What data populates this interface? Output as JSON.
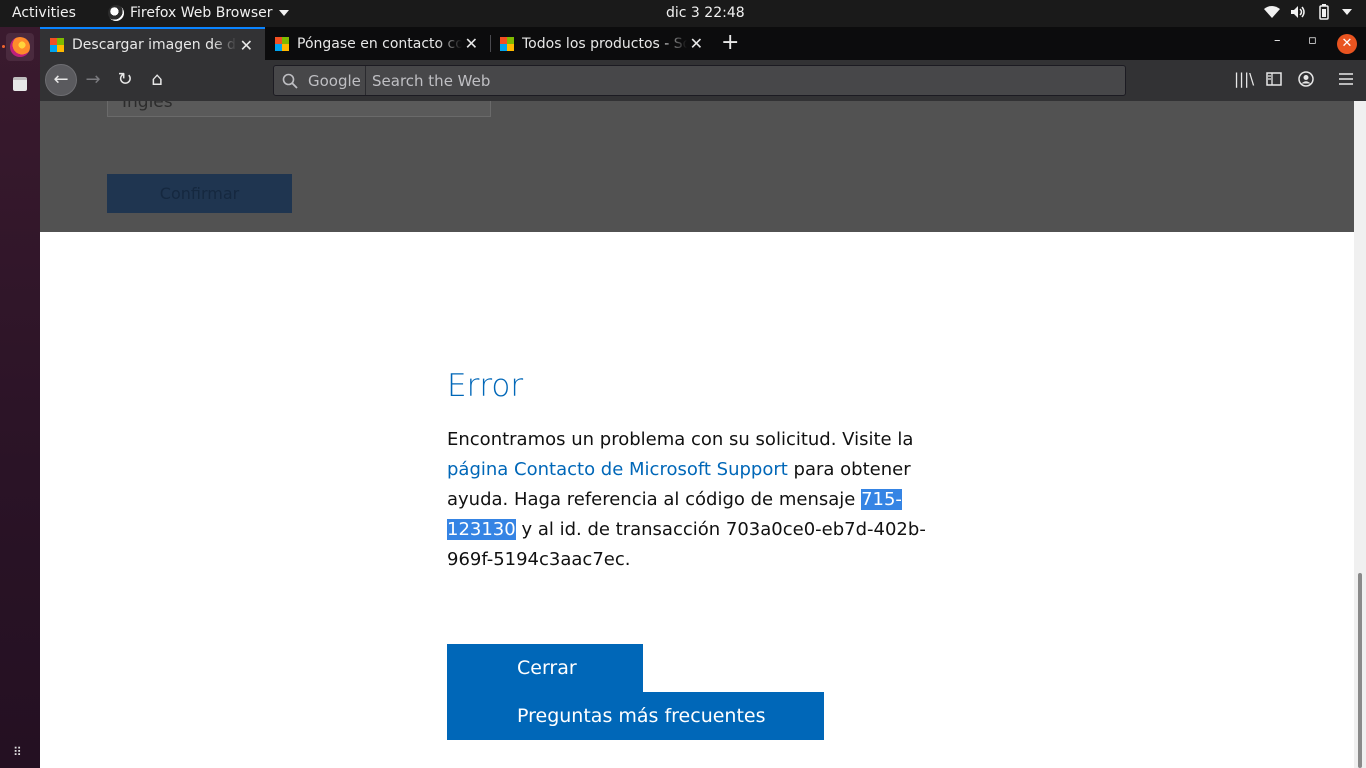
{
  "system": {
    "activities": "Activities",
    "app_name": "Firefox Web Browser",
    "clock": "dic 3  22:48"
  },
  "tabs": [
    {
      "title": "Descargar imagen de disco",
      "active": true
    },
    {
      "title": "Póngase en contacto con",
      "active": false
    },
    {
      "title": "Todos los productos - Soporte",
      "active": false
    }
  ],
  "navbar": {
    "search_engine": "Google",
    "search_placeholder": "Search the Web"
  },
  "overlay": {
    "select_value": "Inglés",
    "confirm_label": "Confirmar"
  },
  "error": {
    "title": "Error",
    "text1": "Encontramos un problema con su solicitud. Visite la ",
    "link": "página Contacto de Microsoft Support",
    "text2": " para obtener ayuda. Haga referencia al código de mensaje ",
    "code": "715-123130",
    "text3": " y al id. de transacción 703a0ce0-eb7d-402b-969f-5194c3aac7ec.",
    "close_label": "Cerrar",
    "faq_label": "Preguntas más frecuentes"
  },
  "colors": {
    "ms_blue": "#0067b8",
    "tab_accent": "#0a84ff",
    "close_orange": "#e95420",
    "selection": "#3584e4"
  }
}
